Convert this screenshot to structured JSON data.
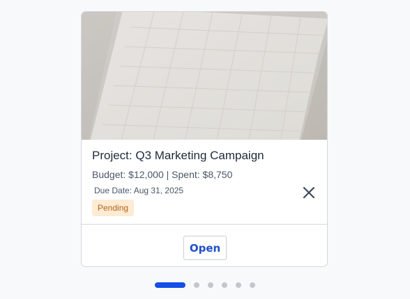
{
  "card": {
    "title": "Project: Q3 Marketing Campaign",
    "budget_line": "Budget: $12,000 | Spent: $8,750",
    "due_line": "Due Date: Aug 31, 2025",
    "status": "Pending",
    "open_label": "Open",
    "close_icon": "close-icon",
    "image_subject": "paper-calendar-photo"
  },
  "carousel": {
    "dot_count": 6,
    "active_index": 0
  },
  "colors": {
    "accent": "#1450e6",
    "badge_bg": "#fdebd3",
    "badge_text": "#b5621c",
    "title_text": "#1d2a3a"
  }
}
